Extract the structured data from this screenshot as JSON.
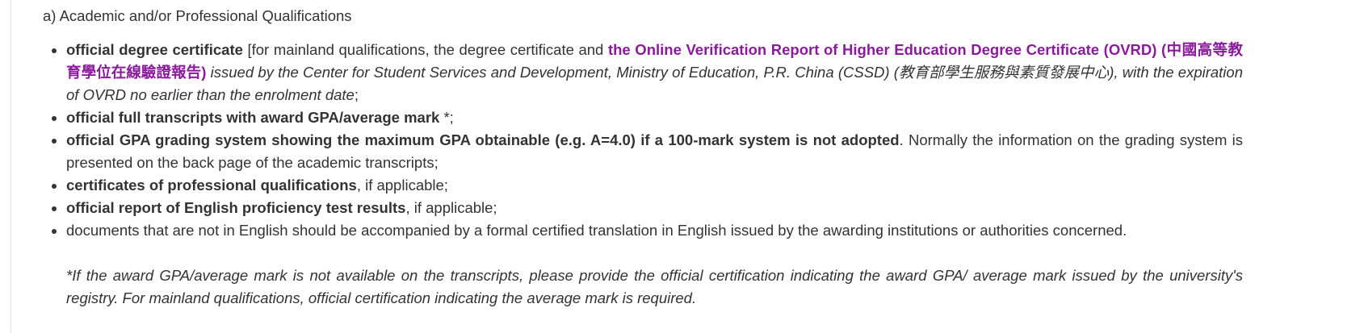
{
  "section": {
    "heading": "a) Academic and/or Professional Qualifications"
  },
  "items": {
    "degree": {
      "bold": "official degree certificate",
      "text1": " [for mainland qualifications, the degree certificate and ",
      "link": "the Online Verification Report of Higher Education Degree Certificate (OVRD) (中國高等教育學位在線驗證報告)",
      "italic": " issued by the Center for Student Services and Development, Ministry of Education, P.R. China (CSSD) (教育部學生服務與素質發展中心), with the expiration of OVRD no earlier than the enrolment date",
      "end": ";"
    },
    "transcripts": {
      "bold": "official full transcripts with award GPA/average mark",
      "end": " *;"
    },
    "gpa": {
      "bold": "official GPA grading system showing the maximum GPA obtainable (e.g. A=4.0) if a 100-mark system is not adopted",
      "text": ". Normally the information on the grading system is presented on the back page of the academic transcripts;"
    },
    "professional": {
      "bold": "certificates of professional qualifications",
      "text": ", if applicable;"
    },
    "english": {
      "bold": "official report of English proficiency test results",
      "text": ", if applicable;"
    },
    "translation": {
      "text": "documents that are not in English should be accompanied by a formal certified translation in English issued by the awarding institutions or authorities concerned."
    }
  },
  "footnote": "*If the award GPA/average mark is not available on the transcripts, please provide the official certification indicating the award GPA/ average mark issued by the university's registry. For mainland qualifications, official certification indicating the average mark is required."
}
